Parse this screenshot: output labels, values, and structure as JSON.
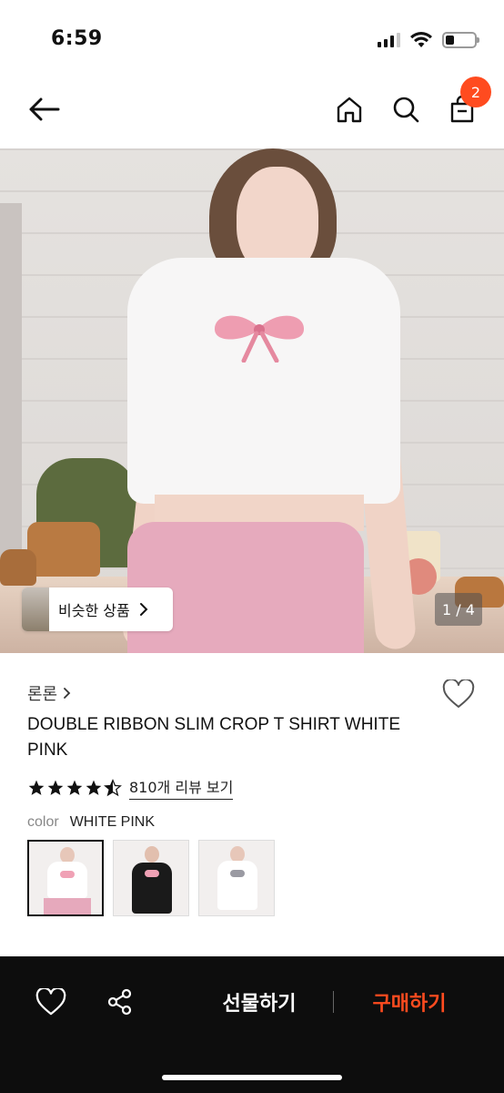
{
  "status": {
    "time": "6:59"
  },
  "header": {
    "cart_count": "2"
  },
  "hero": {
    "similar_label": "비슷한 상품",
    "page_indicator": "1 / 4",
    "image_description_icon": "product-photo"
  },
  "product": {
    "brand": "론론",
    "title": "DOUBLE RIBBON SLIM CROP T SHIRT WHITE PINK",
    "rating": 4.5,
    "review_link": "810개 리뷰 보기",
    "option_key": "color",
    "option_value": "WHITE PINK",
    "swatches": [
      {
        "shirt": "#ffffff",
        "bow": "#f0a1b5",
        "selected": true
      },
      {
        "shirt": "#1a1a1a",
        "bow": "#f0a1b5",
        "selected": false
      },
      {
        "shirt": "#ffffff",
        "bow": "#9a9aa2",
        "selected": false
      }
    ]
  },
  "bottom_bar": {
    "gift_label": "선물하기",
    "buy_label": "구매하기"
  },
  "colors": {
    "accent": "#ff4b1f",
    "bar": "#0d0d0d"
  }
}
